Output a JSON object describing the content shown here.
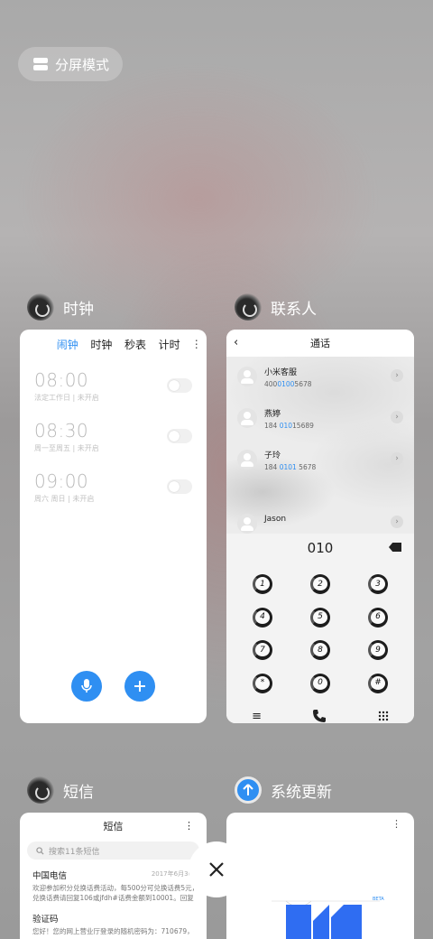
{
  "split_mode": {
    "label": "分屏模式",
    "icon": "split-screen-icon"
  },
  "apps": {
    "clock": {
      "name": "时钟",
      "tabs": [
        "闹钟",
        "时钟",
        "秒表",
        "计时"
      ],
      "active_tab": "闹钟",
      "alarms": [
        {
          "time": "08:00",
          "subtitle": "法定工作日 | 未开启",
          "enabled": false
        },
        {
          "time": "08:30",
          "subtitle": "周一至周五 | 未开启",
          "enabled": false
        },
        {
          "time": "09:00",
          "subtitle": "周六 周日 | 未开启",
          "enabled": false
        }
      ]
    },
    "contacts": {
      "name": "联系人",
      "title": "通话",
      "entries": [
        {
          "name": "小米客服",
          "num_pre": "400",
          "num_hl": "0100",
          "num_post": "5678"
        },
        {
          "name": "燕婷",
          "num_pre": "184 ",
          "num_hl": "010",
          "num_post": "15689"
        },
        {
          "name": "子玲",
          "num_pre": "184 ",
          "num_hl": "0101",
          "num_post": " 5678"
        },
        {
          "name": "Jason",
          "num_pre": "",
          "num_hl": "",
          "num_post": ""
        }
      ],
      "dial_input": "010",
      "keys": [
        "1",
        "2",
        "3",
        "4",
        "5",
        "6",
        "7",
        "8",
        "9",
        "*",
        "0",
        "#"
      ]
    },
    "sms": {
      "name": "短信",
      "title": "短信",
      "search_placeholder": "搜索11条短信",
      "messages": [
        {
          "sender": "中国电信",
          "date": "2017年6月30",
          "preview_1": "欢迎参加积分兑换话费活动，每500分可兑换话费5元，",
          "preview_2": "兑换话费请回复106或jfdh#话费金额到10001。回复..."
        },
        {
          "sender": "验证码",
          "date": "",
          "preview_1": "您好！您的网上营业厅登录的随机密码为：710679，有",
          "preview_2": ""
        }
      ]
    },
    "update": {
      "name": "系统更新",
      "badge": "BETA"
    }
  },
  "colors": {
    "accent": "#2f8ff2"
  }
}
